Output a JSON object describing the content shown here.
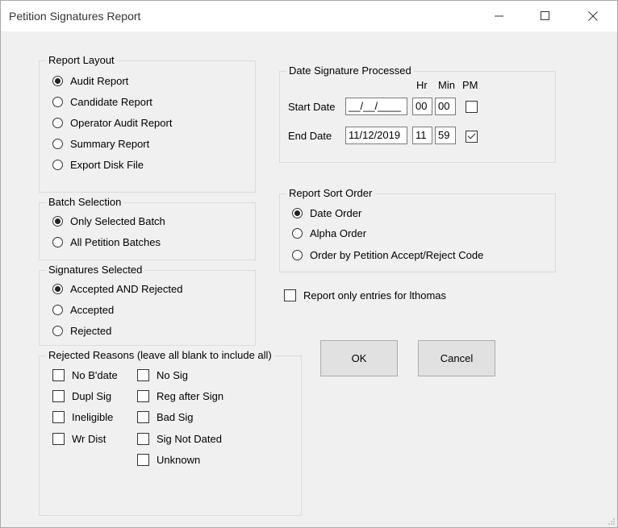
{
  "window": {
    "title": "Petition Signatures Report"
  },
  "titlebar": {
    "minimize": "─",
    "maximize": "☐",
    "close": "✕"
  },
  "report_layout": {
    "title": "Report Layout",
    "options": [
      "Audit Report",
      "Candidate Report",
      "Operator Audit Report",
      "Summary Report",
      "Export Disk File"
    ],
    "selected": "Audit Report"
  },
  "batch_selection": {
    "title": "Batch Selection",
    "options": [
      "Only Selected Batch",
      "All Petition Batches"
    ],
    "selected": "Only Selected Batch"
  },
  "signatures_selected": {
    "title": "Signatures Selected",
    "options": [
      "Accepted AND Rejected",
      "Accepted",
      "Rejected"
    ],
    "selected": "Accepted AND Rejected"
  },
  "rejected_reasons": {
    "title": "Rejected Reasons (leave all blank to include all)",
    "left": [
      "No B'date",
      "Dupl Sig",
      "Ineligible",
      "Wr Dist"
    ],
    "right": [
      "No Sig",
      "Reg after Sign",
      "Bad Sig",
      "Sig Not Dated",
      "Unknown"
    ]
  },
  "date_processed": {
    "title": "Date Signature Processed",
    "hr_label": "Hr",
    "min_label": "Min",
    "pm_label": "PM",
    "start": {
      "label": "Start Date",
      "date": "__/__/____",
      "hr": "00",
      "min": "00",
      "pm": false
    },
    "end": {
      "label": "End Date",
      "date": "11/12/2019",
      "hr": "11",
      "min": "59",
      "pm": true
    }
  },
  "sort_order": {
    "title": "Report Sort Order",
    "options": [
      "Date Order",
      "Alpha Order",
      "Order by Petition Accept/Reject Code"
    ],
    "selected": "Date Order"
  },
  "only_entries": {
    "label": "Report only entries for lthomas",
    "checked": false
  },
  "buttons": {
    "ok": "OK",
    "cancel": "Cancel"
  }
}
